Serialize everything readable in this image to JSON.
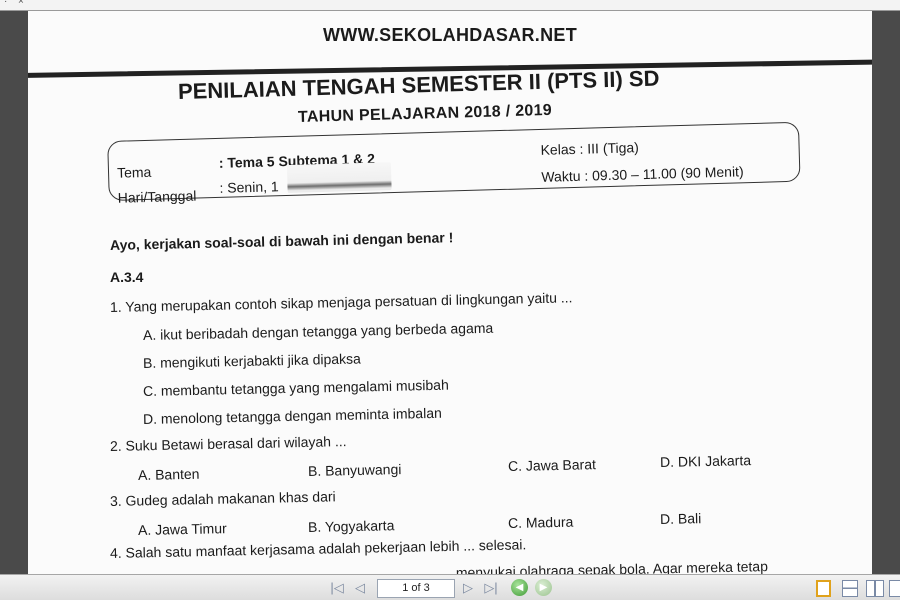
{
  "window": {
    "close_glyph": "×",
    "corner_glyph": "·"
  },
  "document": {
    "site_header": "WWW.SEKOLAHDASAR.NET",
    "title": "PENILAIAN TENGAH SEMESTER II (PTS II) SD",
    "year_line": "TAHUN PELAJARAN 2018 / 2019",
    "info": {
      "tema_label": "Tema",
      "tema_value": ": Tema 5 Subtema 1 & 2",
      "hari_label": "Hari/Tanggal",
      "hari_value": ": Senin, 1",
      "kelas": "Kelas  : III (Tiga)",
      "waktu": "Waktu : 09.30 – 11.00 (90 Menit)"
    },
    "instruction": "Ayo, kerjakan soal-soal di bawah ini dengan benar !",
    "section": "A.3.4",
    "questions": [
      {
        "text": "1.   Yang merupakan contoh sikap menjaga persatuan di lingkungan yaitu ...",
        "options": [
          "A.  ikut beribadah dengan tetangga yang berbeda agama",
          "B.  mengikuti kerjabakti jika dipaksa",
          "C.  membantu tetangga yang mengalami musibah",
          "D.  menolong tetangga dengan meminta imbalan"
        ]
      },
      {
        "text": "2.   Suku Betawi berasal dari wilayah ...",
        "options": [
          "A. Banten",
          "B. Banyuwangi",
          "C. Jawa Barat",
          "D. DKI Jakarta"
        ]
      },
      {
        "text": "3.   Gudeg adalah makanan khas dari",
        "options": [
          "A. Jawa Timur",
          "B. Yogyakarta",
          "C. Madura",
          "D. Bali"
        ]
      },
      {
        "text": "4.   Salah satu manfaat kerjasama adalah pekerjaan lebih ... selesai."
      }
    ],
    "partial_line": "… menyukai olahraga sepak bola. Agar mereka tetap"
  },
  "toolbar": {
    "page_indicator": "1 of 3",
    "first_glyph": "|◁",
    "prev_glyph": "◁",
    "next_glyph": "▷",
    "last_glyph": "▷|",
    "back_glyph": "◀",
    "forward_glyph": "▶"
  }
}
